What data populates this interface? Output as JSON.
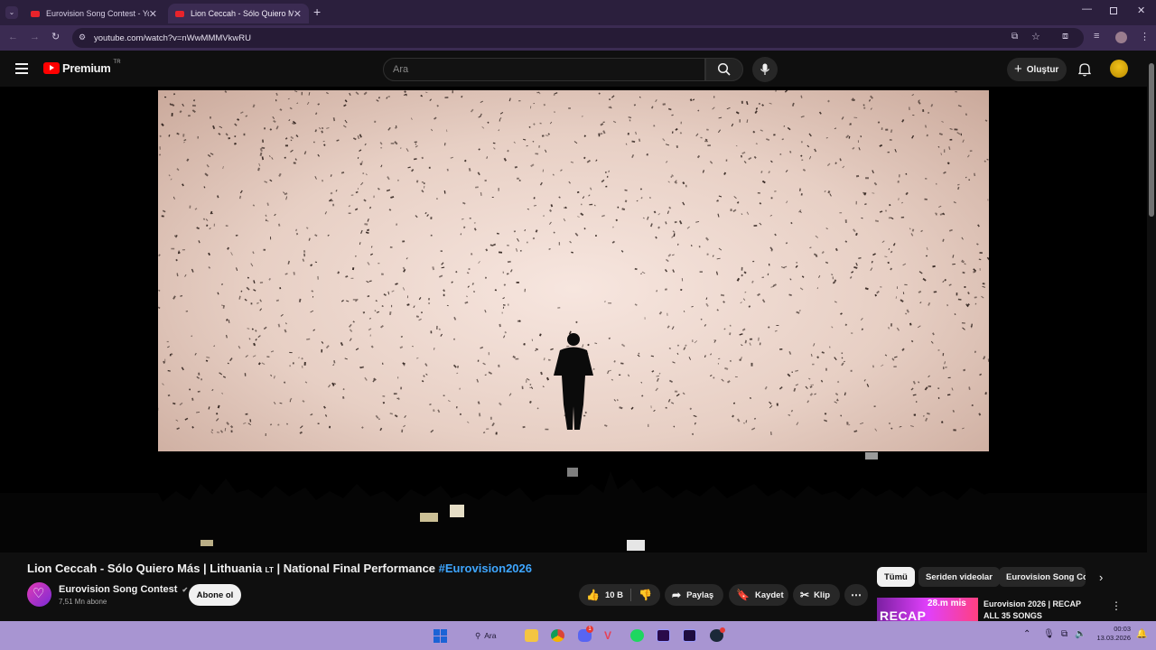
{
  "browser": {
    "tabs": [
      {
        "label": "Eurovision Song Contest - YouT"
      },
      {
        "label": "Lion Ceccah - Sólo Quiero Más"
      }
    ],
    "url": "youtube.com/watch?v=nWwMMMVkwRU"
  },
  "header": {
    "brand": "Premium",
    "region": "TR",
    "search_placeholder": "Ara",
    "create_label": "Oluştur"
  },
  "video": {
    "title": "Lion Ceccah - Sólo Quiero Más | Lithuania 🇱🇹 | National Final Performance",
    "hashtag": "#Eurovision2026",
    "title_prefix": "Lion Ceccah - Sólo Quiero Más | Lithuania ",
    "flag_text": "LT",
    "title_suffix": " | National Final Performance "
  },
  "channel": {
    "name": "Eurovision Song Contest",
    "subscribers": "7,51 Mn abone",
    "subscribe_label": "Abone ol"
  },
  "actions": {
    "likes": "10 B",
    "share": "Paylaş",
    "save": "Kaydet",
    "clip": "Klip"
  },
  "chips": [
    "Tümü",
    "Seriden videolar",
    "Eurovision Song Contest"
  ],
  "recommendation": {
    "thumb_text": "RECAP",
    "thumb_overlay": "28.m mis",
    "title": "Eurovision 2026 | RECAP ALL 35 SONGS"
  },
  "taskbar": {
    "search_label": "Ara",
    "chat_badge": "1",
    "time": "00:03",
    "date": "13.03.2026"
  },
  "colors": {
    "browser_tabbar": "#2b1f3d",
    "browser_toolbar": "#3b2b52",
    "youtube_red": "#ff0000",
    "link_blue": "#3ea6ff",
    "taskbar": "#a895d2"
  }
}
